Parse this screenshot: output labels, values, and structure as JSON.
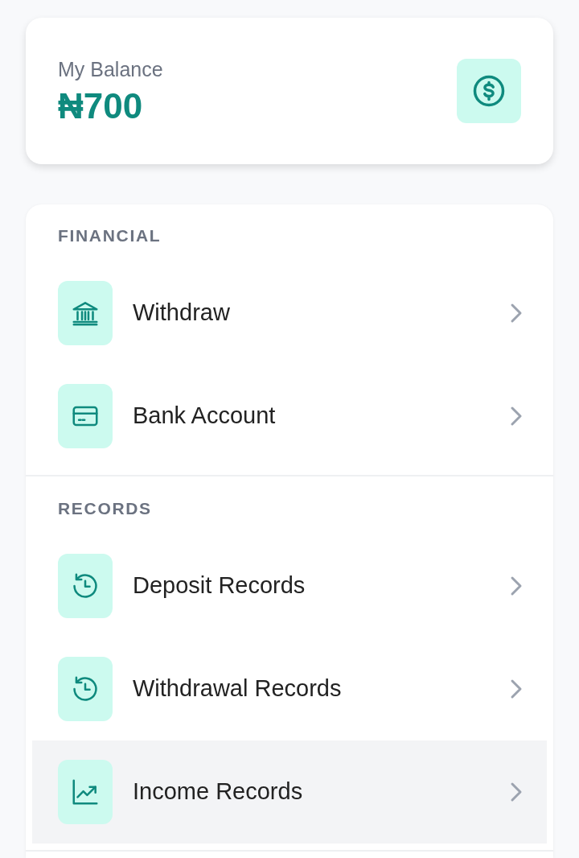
{
  "balance": {
    "label": "My Balance",
    "amount": "₦700"
  },
  "sections": [
    {
      "title": "FINANCIAL",
      "items": [
        {
          "label": "Withdraw",
          "kind": "bank",
          "selected": false
        },
        {
          "label": "Bank Account",
          "kind": "card",
          "selected": false
        }
      ]
    },
    {
      "title": "RECORDS",
      "items": [
        {
          "label": "Deposit Records",
          "kind": "history",
          "selected": false
        },
        {
          "label": "Withdrawal Records",
          "kind": "history",
          "selected": false
        },
        {
          "label": "Income Records",
          "kind": "chart",
          "selected": true
        }
      ]
    }
  ]
}
